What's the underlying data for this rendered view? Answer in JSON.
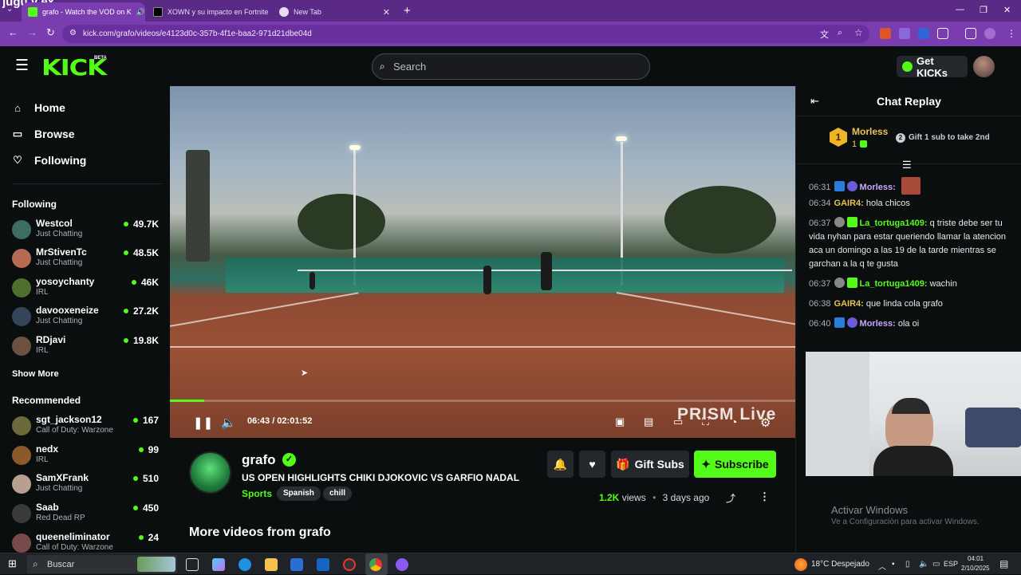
{
  "browser": {
    "tabs": [
      {
        "label": "grafo - Watch the VOD on K",
        "active": true
      },
      {
        "label": "XOWN y su impacto en Fortnite",
        "active": false
      },
      {
        "label": "New Tab",
        "active": false
      }
    ],
    "url": "kick.com/grafo/videos/e4123d0c-357b-4f1e-baa2-971d21dbe04d",
    "overlay_text": "jugu y ex"
  },
  "header": {
    "logo": "KICK",
    "beta": "BETA",
    "search_placeholder": "Search",
    "get_kicks": "Get KICKs"
  },
  "sidebar": {
    "nav": [
      {
        "label": "Home",
        "icon": "home-icon"
      },
      {
        "label": "Browse",
        "icon": "browse-icon"
      },
      {
        "label": "Following",
        "icon": "heart-icon"
      }
    ],
    "following_title": "Following",
    "following": [
      {
        "name": "Westcol",
        "category": "Just Chatting",
        "viewers": "49.7K",
        "color": "#3b6d64"
      },
      {
        "name": "MrStivenTc",
        "category": "Just Chatting",
        "viewers": "48.5K",
        "color": "#b56b53"
      },
      {
        "name": "yosoychanty",
        "category": "IRL",
        "viewers": "46K",
        "color": "#4f6f2f"
      },
      {
        "name": "davooxeneize",
        "category": "Just Chatting",
        "viewers": "27.2K",
        "color": "#34455a"
      },
      {
        "name": "RDjavi",
        "category": "IRL",
        "viewers": "19.8K",
        "color": "#6b5140"
      }
    ],
    "show_more": "Show More",
    "recommended_title": "Recommended",
    "recommended": [
      {
        "name": "sgt_jackson12",
        "category": "Call of Duty: Warzone",
        "viewers": "167",
        "color": "#6a6a3a"
      },
      {
        "name": "nedx",
        "category": "IRL",
        "viewers": "99",
        "color": "#8a5a2a"
      },
      {
        "name": "SamXFrank",
        "category": "Just Chatting",
        "viewers": "510",
        "color": "#b8a090"
      },
      {
        "name": "Saab",
        "category": "Red Dead RP",
        "viewers": "450",
        "color": "#3a3a3a"
      },
      {
        "name": "queeneliminator",
        "category": "Call of Duty: Warzone",
        "viewers": "24",
        "color": "#7a4a4a"
      }
    ]
  },
  "player": {
    "current": "06:43",
    "duration": "02:01:52",
    "timecode": "06:43 / 02:01:52",
    "progress_fraction": 0.055,
    "watermark": "PRISM Live"
  },
  "video": {
    "channel": "grafo",
    "title": "US OPEN HIGHLIGHTS CHIKI DJOKOVIC VS GARFIO NADAL",
    "category": "Sports",
    "tags": [
      "Spanish",
      "chill"
    ],
    "gift_subs": "Gift Subs",
    "subscribe": "Subscribe",
    "views_count": "1.2K",
    "views_label": "views",
    "age": "3 days ago",
    "more_videos": "More videos from grafo"
  },
  "chat": {
    "title": "Chat Replay",
    "leader": {
      "rank": "1",
      "name": "Morless",
      "subs": "1",
      "gift_rank": "2",
      "gift_text": "Gift 1 sub to take 2nd"
    },
    "messages": [
      {
        "time": "06:31",
        "user": "Morless:",
        "text": "",
        "color": "#c9a6ff"
      },
      {
        "time": "06:34",
        "user": "GAIR4:",
        "text": "hola chicos",
        "color": "#e6c35a"
      },
      {
        "time": "06:37",
        "user": "La_tortuga1409:",
        "text": "q triste debe ser tu vida nyhan para estar queriendo llamar la atencion aca un domingo a las 19 de la tarde mientras se garchan a la q te gusta",
        "color": "#53fc18"
      },
      {
        "time": "06:37",
        "user": "La_tortuga1409:",
        "text": "wachin",
        "color": "#53fc18"
      },
      {
        "time": "06:38",
        "user": "GAIR4:",
        "text": "que linda cola grafo",
        "color": "#e6c35a"
      },
      {
        "time": "06:40",
        "user": "Morless:",
        "text": "ola oi",
        "color": "#c9a6ff"
      }
    ],
    "activate_title": "Activar Windows",
    "activate_sub": "Ve a Configuración para activar Windows."
  },
  "taskbar": {
    "search": "Buscar",
    "weather": "18°C  Despejado",
    "lang": "ESP",
    "time": "04:01",
    "date": "2/10/2025"
  },
  "colors": {
    "accent": "#53fc18",
    "browser": "#7a3db0"
  }
}
